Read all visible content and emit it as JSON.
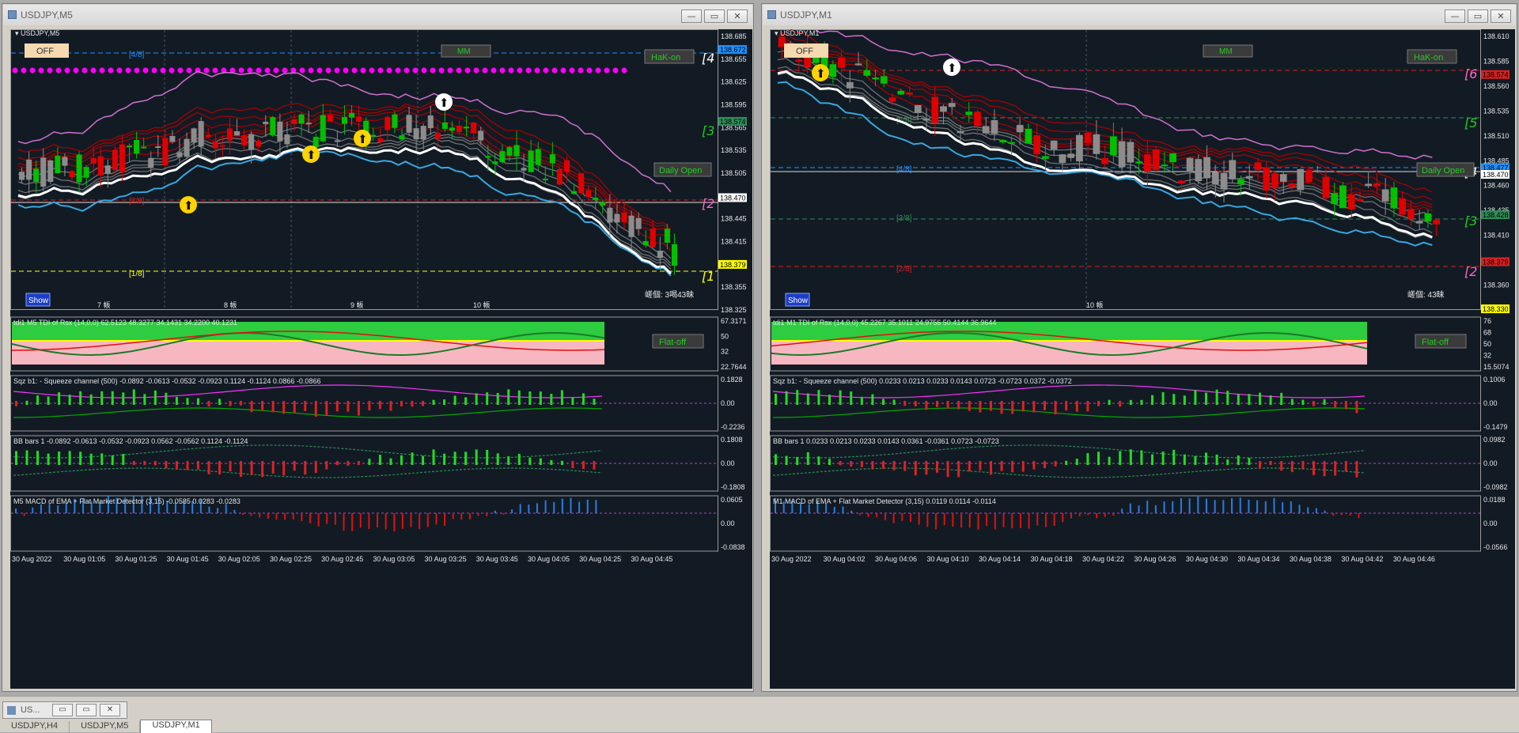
{
  "windows": [
    {
      "id": "left",
      "title": "USDJPY,M5",
      "chart_label": "USDJPY,M5",
      "prices": [
        "138.685",
        "138.655",
        "138.625",
        "138.595",
        "138.565",
        "138.535",
        "138.505",
        "138.470",
        "138.445",
        "138.415",
        "138.385",
        "138.355",
        "138.325"
      ],
      "price_tags": [
        {
          "text": "138.672",
          "color": "#1e90ff",
          "at": "138.672"
        },
        {
          "text": "138.574",
          "color": "#2e8b57",
          "at": "138.574"
        },
        {
          "text": "138.470",
          "color": "#ffffff",
          "at": "138.470"
        },
        {
          "text": "138.379",
          "color": "#ffff00",
          "at": "138.379"
        }
      ],
      "murrey_labels": [
        "[4/8]",
        "[2/8]",
        "[1/8]"
      ],
      "right_marks": [
        "[4",
        "[3",
        "[2",
        "[1"
      ],
      "date_labels": [
        "7 帳",
        "8 帳",
        "9 帳",
        "10 帳"
      ],
      "countdown": "嵯個: 3喝43昧",
      "buttons": {
        "off": "OFF",
        "mm": "MM",
        "hak": "HaK-on",
        "daily": "Daily Open",
        "show": "Show",
        "flat": "Flat-off"
      },
      "tdi": {
        "label": "tdi1 M5 TDI of Rsx (14,0,0) 62.5123 48.3277 34.1431 34.2200 40.1231",
        "scale": [
          "67.3171",
          "50",
          "32",
          "22.7644"
        ]
      },
      "sqz": {
        "label": "Sqz b1: - Squeeze channel (500) -0.0892 -0.0613 -0.0532 -0.0923 0.1124 -0.1124 0.0866 -0.0866",
        "scale": [
          "0.1828",
          "0.00",
          "-0.2236"
        ]
      },
      "bb": {
        "label": "BB bars 1 -0.0892 -0.0613 -0.0532 -0.0923 0.0562 -0.0562 0.1124 -0.1124",
        "scale": [
          "0.1808",
          "0.00",
          "-0.1808"
        ]
      },
      "macd": {
        "label": "M5 MACD of EMA + Flat Market Detector (3,15) -0.0585 0.0283 -0.0283",
        "scale": [
          "0.0605",
          "0.00",
          "-0.0838"
        ]
      },
      "time_labels": [
        "30 Aug 2022",
        "30 Aug 01:05",
        "30 Aug 01:25",
        "30 Aug 01:45",
        "30 Aug 02:05",
        "30 Aug 02:25",
        "30 Aug 02:45",
        "30 Aug 03:05",
        "30 Aug 03:25",
        "30 Aug 03:45",
        "30 Aug 04:05",
        "30 Aug 04:25",
        "30 Aug 04:45"
      ]
    },
    {
      "id": "right",
      "title": "USDJPY,M1",
      "chart_label": "USDJPY,M1",
      "prices": [
        "138.610",
        "138.585",
        "138.560",
        "138.535",
        "138.510",
        "138.485",
        "138.460",
        "138.435",
        "138.410",
        "138.385",
        "138.360",
        "138.335"
      ],
      "price_tags": [
        {
          "text": "138.574",
          "color": "#d62020",
          "at": "138.574"
        },
        {
          "text": "138.477",
          "color": "#1e90ff",
          "at": "138.477"
        },
        {
          "text": "138.470",
          "color": "#ffffff",
          "at": "138.470"
        },
        {
          "text": "138.428",
          "color": "#2e8b57",
          "at": "138.428"
        },
        {
          "text": "138.379",
          "color": "#d62020",
          "at": "138.379"
        },
        {
          "text": "138.330",
          "color": "#ffff00",
          "at": "138.330"
        }
      ],
      "murrey_labels": [
        "[5/8]",
        "[4/8]",
        "[3/8]",
        "[2/8]"
      ],
      "right_marks": [
        "[6",
        "[5",
        "[4",
        "[3",
        "[2"
      ],
      "date_labels": [
        "10 帳"
      ],
      "countdown": "嵯個: 43昧",
      "buttons": {
        "off": "OFF",
        "mm": "MM",
        "hak": "HaK-on",
        "daily": "Daily Open",
        "show": "Show",
        "flat": "Flat-off"
      },
      "tdi": {
        "label": "tdi1 M1 TDI of Rsx (14,0,0) 45.2267 35.1011 24.9756 50.4144 36.9644",
        "scale": [
          "76",
          "68",
          "50",
          "32",
          "15.5074"
        ]
      },
      "sqz": {
        "label": "Sqz b1: - Squeeze channel (500) 0.0233 0.0213 0.0233 0.0143 0.0723 -0.0723 0.0372 -0.0372",
        "scale": [
          "0.1006",
          "0.00",
          "-0.1479"
        ]
      },
      "bb": {
        "label": "BB bars 1 0.0233 0.0213 0.0233 0.0143 0.0361 -0.0361 0.0723 -0.0723",
        "scale": [
          "0.0982",
          "0.00",
          "-0.0982"
        ]
      },
      "macd": {
        "label": "M1 MACD of EMA + Flat Market Detector (3,15) 0.0119 0.0114 -0.0114",
        "scale": [
          "0.0188",
          "0.00",
          "-0.0566"
        ]
      },
      "time_labels": [
        "30 Aug 2022",
        "30 Aug 04:02",
        "30 Aug 04:06",
        "30 Aug 04:10",
        "30 Aug 04:14",
        "30 Aug 04:18",
        "30 Aug 04:22",
        "30 Aug 04:26",
        "30 Aug 04:30",
        "30 Aug 04:34",
        "30 Aug 04:38",
        "30 Aug 04:42",
        "30 Aug 04:46"
      ]
    }
  ],
  "window_buttons": {
    "minimize": "—",
    "restore": "▭",
    "close": "✕"
  },
  "taskbar": {
    "minimized_title": "US...",
    "tabs": [
      {
        "label": "USDJPY,H4",
        "active": false
      },
      {
        "label": "USDJPY,M5",
        "active": false
      },
      {
        "label": "USDJPY,M1",
        "active": true
      }
    ]
  },
  "colors": {
    "background": "#121b24",
    "bull": "#00c000",
    "bear": "#e00000",
    "neutral": "#8c8c8c"
  }
}
